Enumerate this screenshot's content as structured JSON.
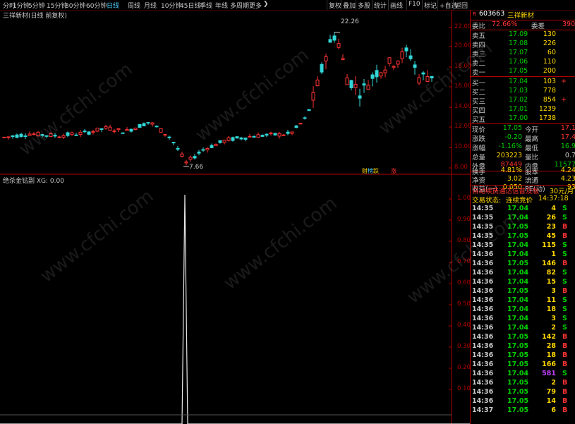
{
  "toolbar": {
    "periods": [
      "分时",
      "1分钟",
      "5分钟",
      "15分钟",
      "30分钟",
      "60分钟",
      "日线",
      "周线",
      "月线",
      "10分钟",
      "45日线",
      "季线",
      "年线",
      "多周期",
      "更多"
    ],
    "active_period": "日线",
    "tools": [
      "复权",
      "叠加",
      "多股",
      "统计",
      "画线",
      "F10",
      "标记",
      "+自选",
      "返回"
    ]
  },
  "chart": {
    "title": "三祥新材(日线 前复权)",
    "indicator_title": "绝杀金钻副 XG: 0.00",
    "high_label": "22.26",
    "low_label": "7.66",
    "badges": [
      "财",
      "榜",
      "跌",
      "涨"
    ]
  },
  "price_axis": [
    "22.00",
    "20.00",
    "18.00",
    "16.00",
    "14.00",
    "12.00",
    "10.00",
    "8.00"
  ],
  "indicator_axis": [
    "1.00",
    "0.90",
    "0.80",
    "0.70",
    "0.60",
    "0.50",
    "0.40",
    "0.30",
    "0.20",
    "0.10"
  ],
  "quote": {
    "code": "603663",
    "name": "三祥新材",
    "weibi_label": "委比",
    "weibi": "72.66%",
    "weicha_label": "委差",
    "weicha": "390",
    "sells": [
      {
        "label": "卖五",
        "price": "17.09",
        "vol": "130"
      },
      {
        "label": "卖四",
        "price": "17.08",
        "vol": "226"
      },
      {
        "label": "卖三",
        "price": "17.07",
        "vol": "60"
      },
      {
        "label": "卖二",
        "price": "17.06",
        "vol": "110"
      },
      {
        "label": "卖一",
        "price": "17.05",
        "vol": "200"
      }
    ],
    "buys": [
      {
        "label": "买一",
        "price": "17.04",
        "vol": "103",
        "chg": "+"
      },
      {
        "label": "买二",
        "price": "17.03",
        "vol": "778",
        "chg": ""
      },
      {
        "label": "买三",
        "price": "17.02",
        "vol": "854",
        "chg": "+"
      },
      {
        "label": "买四",
        "price": "17.01",
        "vol": "1239",
        "chg": ""
      },
      {
        "label": "买五",
        "price": "17.00",
        "vol": "1738",
        "chg": ""
      }
    ],
    "stats": [
      {
        "l1": "现价",
        "v1": "17.05",
        "l2": "今开",
        "v2": "17.1"
      },
      {
        "l1": "涨跌",
        "v1": "-0.20",
        "l2": "最高",
        "v2": "17.4"
      },
      {
        "l1": "涨幅",
        "v1": "-1.16%",
        "l2": "最低",
        "v2": "16.9"
      },
      {
        "l1": "总量",
        "v1": "203223",
        "l2": "量比",
        "v2": "0.7"
      },
      {
        "l1": "外盘",
        "v1": "87449",
        "l2": "内盘",
        "v2": "11577"
      }
    ],
    "stats2": [
      {
        "l1": "换手",
        "v1": "4.81%",
        "l2": "股本",
        "v2": "4.24"
      },
      {
        "l1": "净资",
        "v1": "3.02",
        "l2": "流通",
        "v2": "4.23"
      },
      {
        "l1": "收益(一)",
        "v1": "0.050",
        "l2": "PE(动)",
        "v2": "93"
      }
    ],
    "ad_text": "自动续费通达信普及版",
    "ad_price": "30元/月",
    "status_label": "交易状态:",
    "status_value": "连续竞价",
    "status_time": "14:37:18"
  },
  "ticks": [
    {
      "t": "14:35",
      "p": "17.04",
      "v": "4",
      "s": "S"
    },
    {
      "t": "14:35",
      "p": "17.04",
      "v": "26",
      "s": "S"
    },
    {
      "t": "14:35",
      "p": "17.05",
      "v": "23",
      "s": "B"
    },
    {
      "t": "14:35",
      "p": "17.05",
      "v": "45",
      "s": "B"
    },
    {
      "t": "14:35",
      "p": "17.04",
      "v": "115",
      "s": "S"
    },
    {
      "t": "14:36",
      "p": "17.04",
      "v": "1",
      "s": "S"
    },
    {
      "t": "14:36",
      "p": "17.05",
      "v": "146",
      "s": "B"
    },
    {
      "t": "14:36",
      "p": "17.04",
      "v": "82",
      "s": "S"
    },
    {
      "t": "14:36",
      "p": "17.04",
      "v": "15",
      "s": "S"
    },
    {
      "t": "14:36",
      "p": "17.05",
      "v": "3",
      "s": "B"
    },
    {
      "t": "14:36",
      "p": "17.04",
      "v": "11",
      "s": "S"
    },
    {
      "t": "14:36",
      "p": "17.04",
      "v": "18",
      "s": "S"
    },
    {
      "t": "14:36",
      "p": "17.04",
      "v": "3",
      "s": "S"
    },
    {
      "t": "14:36",
      "p": "17.04",
      "v": "2",
      "s": "S"
    },
    {
      "t": "14:36",
      "p": "17.05",
      "v": "142",
      "s": "B"
    },
    {
      "t": "14:36",
      "p": "17.05",
      "v": "28",
      "s": "B"
    },
    {
      "t": "14:36",
      "p": "17.05",
      "v": "18",
      "s": "B"
    },
    {
      "t": "14:36",
      "p": "17.05",
      "v": "166",
      "s": "B"
    },
    {
      "t": "14:36",
      "p": "17.04",
      "v": "581",
      "s": "S"
    },
    {
      "t": "14:36",
      "p": "17.05",
      "v": "2",
      "s": "B"
    },
    {
      "t": "14:36",
      "p": "17.05",
      "v": "79",
      "s": "B"
    },
    {
      "t": "14:36",
      "p": "17.05",
      "v": "14",
      "s": "B"
    },
    {
      "t": "14:37",
      "p": "17.05",
      "v": "6",
      "s": "B"
    }
  ],
  "watermark": "www.cfchi.com",
  "colors": {
    "up": "#ff3333",
    "down": "#33d6d6",
    "price": "#ffd700",
    "buy_text": "#ff3333",
    "sell_text": "#00d000",
    "panel_border": "#b00000"
  }
}
